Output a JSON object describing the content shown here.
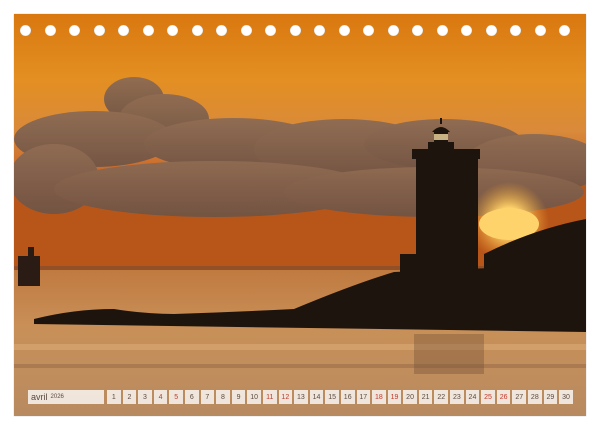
{
  "calendar": {
    "month": "avril",
    "year": "2026",
    "days": [
      "1",
      "2",
      "3",
      "4",
      "5",
      "6",
      "7",
      "8",
      "9",
      "10",
      "11",
      "12",
      "13",
      "14",
      "15",
      "16",
      "17",
      "18",
      "19",
      "20",
      "21",
      "22",
      "23",
      "24",
      "25",
      "26",
      "27",
      "28",
      "29",
      "30"
    ],
    "highlight_days": [
      "4",
      "5",
      "11",
      "12",
      "18",
      "19",
      "25",
      "26"
    ],
    "highlight_color": "#c0392b"
  },
  "binding": {
    "hole_count": 23
  },
  "photo": {
    "icon": "lighthouse-sunset-photo",
    "colors": {
      "sky_top": "#d9780f",
      "sky_mid": "#e89a2a",
      "horizon": "#b8561a",
      "water": "#c08a55",
      "silhouette": "#1e140e",
      "sun": "#ffd36b"
    }
  }
}
